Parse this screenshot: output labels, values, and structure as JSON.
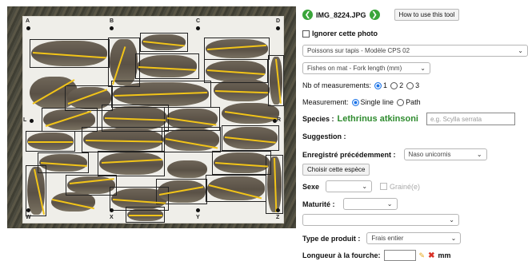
{
  "photo": {
    "corner_labels": {
      "top_left": "A",
      "top_mid": "B",
      "top_mid2": "C",
      "top_right": "D",
      "mid_left": "L",
      "mid_right": "R",
      "bot_left": "W",
      "bot_mid": "X",
      "bot_mid2": "Y",
      "bot_right": "Z"
    },
    "accent": "#f2c418"
  },
  "header": {
    "filename": "IMG_8224.JPG",
    "help_button": "How to use this tool",
    "prev_icon": "arrow-left-icon",
    "next_icon": "arrow-right-icon"
  },
  "ignore": {
    "label": "Ignorer cette photo"
  },
  "model_select": {
    "value": "Poissons sur tapis - Modèle CPS 02"
  },
  "measure_type_select": {
    "value": "Fishes on mat - Fork length (mm)"
  },
  "nb_measurements": {
    "label": "Nb of measurements:",
    "options": [
      "1",
      "2",
      "3"
    ],
    "selected": "1"
  },
  "measurement": {
    "label": "Measurement:",
    "options": [
      "Single line",
      "Path"
    ],
    "selected": "Single line"
  },
  "species": {
    "label": "Species :",
    "value": "Lethrinus atkinsoni",
    "placeholder": "e.g. Scylla serrata"
  },
  "suggestion": {
    "label": "Suggestion :"
  },
  "previous": {
    "label": "Enregistré précédemment :",
    "value": "Naso unicornis",
    "choose_button": "Choisir cette espèce"
  },
  "sex": {
    "label": "Sexe",
    "value": "",
    "grained_label": "Grainé(e)"
  },
  "maturity": {
    "label": "Maturité :",
    "value": ""
  },
  "extra_select": {
    "value": ""
  },
  "product": {
    "label": "Type de produit :",
    "value": "Frais entier"
  },
  "fork_length": {
    "label": "Longueur à la fourche:",
    "unit": "mm"
  },
  "colors": {
    "species_green": "#2e8b2e",
    "nav_green": "#3aa53a",
    "radio_blue": "#1a73e8"
  }
}
